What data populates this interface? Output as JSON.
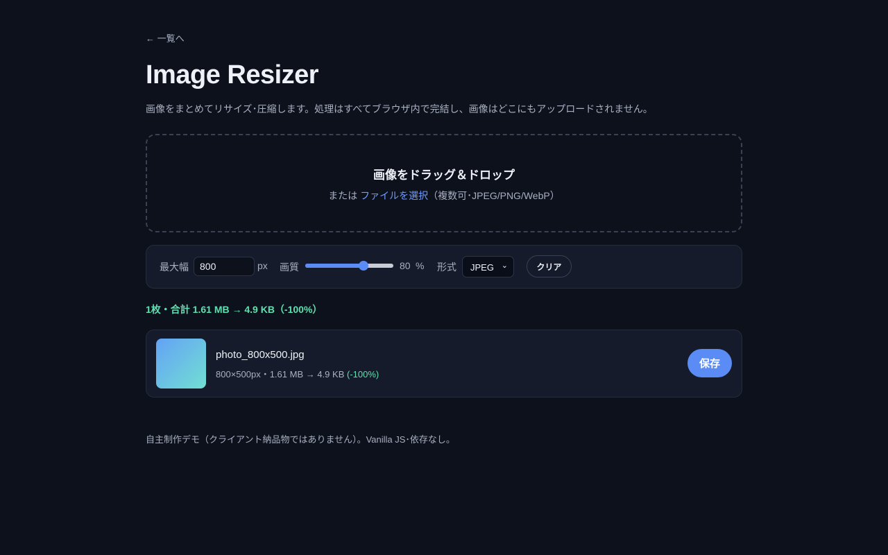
{
  "nav": {
    "back_link": "← 一覧へ"
  },
  "header": {
    "title": "Image Resizer",
    "description": "画像をまとめてリサイズ･圧縮します。処理はすべてブラウザ内で完結し、画像はどこにもアップロードされません。"
  },
  "dropzone": {
    "title": "画像をドラッグ＆ドロップ",
    "prefix": "または",
    "link": "ファイルを選択",
    "suffix": "（複数可･JPEG/PNG/WebP）"
  },
  "controls": {
    "max_width_label": "最大幅",
    "max_width_value": "800",
    "max_width_unit": "px",
    "quality_label": "画質",
    "quality_value": "80",
    "quality_unit": "%",
    "quality_fraction": 0.66,
    "format_label": "形式",
    "format_selected": "JPEG",
    "clear_label": "クリア"
  },
  "summary": {
    "text": "1枚・合計 1.61 MB → 4.9 KB（-100%）"
  },
  "files": [
    {
      "name": "photo_800x500.jpg",
      "meta": "800×500px・1.61 MB → 4.9 KB",
      "reduction": "(-100%)",
      "save_label": "保存"
    }
  ],
  "footer": {
    "text": "自主制作デモ（クライアント納品物ではありません）。Vanilla JS･依存なし。"
  },
  "colors": {
    "background": "#0d111c",
    "accent": "#5b8cf5",
    "success": "#5fe0b0",
    "link": "#6f9bff"
  }
}
